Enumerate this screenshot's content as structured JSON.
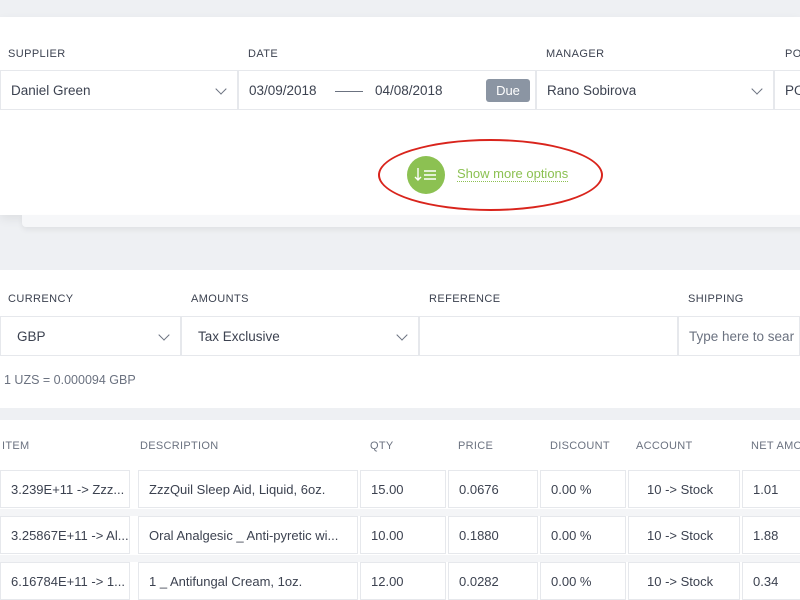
{
  "header": {
    "supplier_label": "SUPPLIER",
    "supplier_value": "Daniel Green",
    "date_label": "DATE",
    "date_from": "03/09/2018",
    "date_to": "04/08/2018",
    "due_label": "Due",
    "manager_label": "MANAGER",
    "manager_value": "Rano Sobirova",
    "po_label": "PO",
    "po_value": "PO",
    "show_more_label": "Show more options"
  },
  "options": {
    "currency_label": "CURRENCY",
    "currency_value": "GBP",
    "amounts_label": "AMOUNTS",
    "amounts_value": "Tax Exclusive",
    "reference_label": "REFERENCE",
    "reference_value": "",
    "shipping_label": "SHIPPING",
    "shipping_placeholder": "Type here to sear",
    "exchange_rate": "1 UZS = 0.000094 GBP"
  },
  "table": {
    "columns": [
      "ITEM",
      "DESCRIPTION",
      "QTY",
      "PRICE",
      "DISCOUNT",
      "ACCOUNT",
      "NET AMO"
    ],
    "rows": [
      {
        "item": "3.239E+11 -> Zzz...",
        "description": "ZzzQuil Sleep Aid, Liquid, 6oz.",
        "qty": "15.00",
        "price": "0.0676",
        "discount": "0.00 %",
        "account": "10 -> Stock",
        "net": "1.01"
      },
      {
        "item": "3.25867E+11 -> Al...",
        "description": "Oral Analgesic _ Anti-pyretic wi...",
        "qty": "10.00",
        "price": "0.1880",
        "discount": "0.00 %",
        "account": "10 -> Stock",
        "net": "1.88"
      },
      {
        "item": "6.16784E+11 -> 1...",
        "description": "1 _ Antifungal Cream, 1oz.",
        "qty": "12.00",
        "price": "0.0282",
        "discount": "0.00 %",
        "account": "10 -> Stock",
        "net": "0.34"
      }
    ]
  },
  "colors": {
    "accent": "#8cc152",
    "annotation": "#d9241c",
    "due_badge": "#8b95a3"
  }
}
